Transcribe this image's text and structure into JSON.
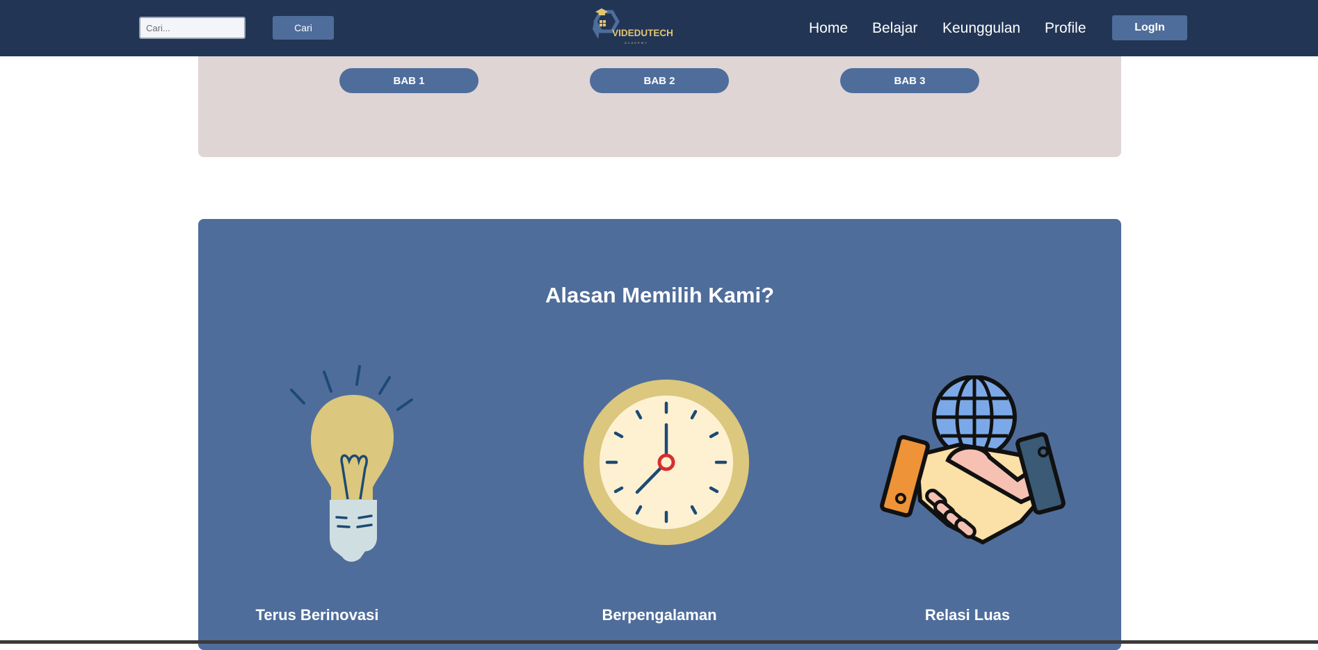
{
  "header": {
    "search": {
      "placeholder": "Cari...",
      "value": ""
    },
    "search_button": "Cari",
    "logo_text": "VIDEDUTECH",
    "logo_subtext": "ACADEMY",
    "nav": [
      {
        "label": "Home"
      },
      {
        "label": "Belajar"
      },
      {
        "label": "Keunggulan"
      },
      {
        "label": "Profile"
      }
    ],
    "login_button": "LogIn"
  },
  "chapters": [
    {
      "label": "BAB 1"
    },
    {
      "label": "BAB 2"
    },
    {
      "label": "BAB 3"
    }
  ],
  "reasons": {
    "title": "Alasan Memilih Kami?",
    "items": [
      {
        "label": "Terus Berinovasi",
        "icon": "lightbulb-icon"
      },
      {
        "label": "Berpengalaman",
        "icon": "clock-icon"
      },
      {
        "label": "Relasi Luas",
        "icon": "handshake-globe-icon"
      }
    ]
  },
  "colors": {
    "navbar": "#223555",
    "accent": "#4f6d9b",
    "chapter_panel": "#dfd5d5",
    "logo_gold": "#e2c56f"
  }
}
